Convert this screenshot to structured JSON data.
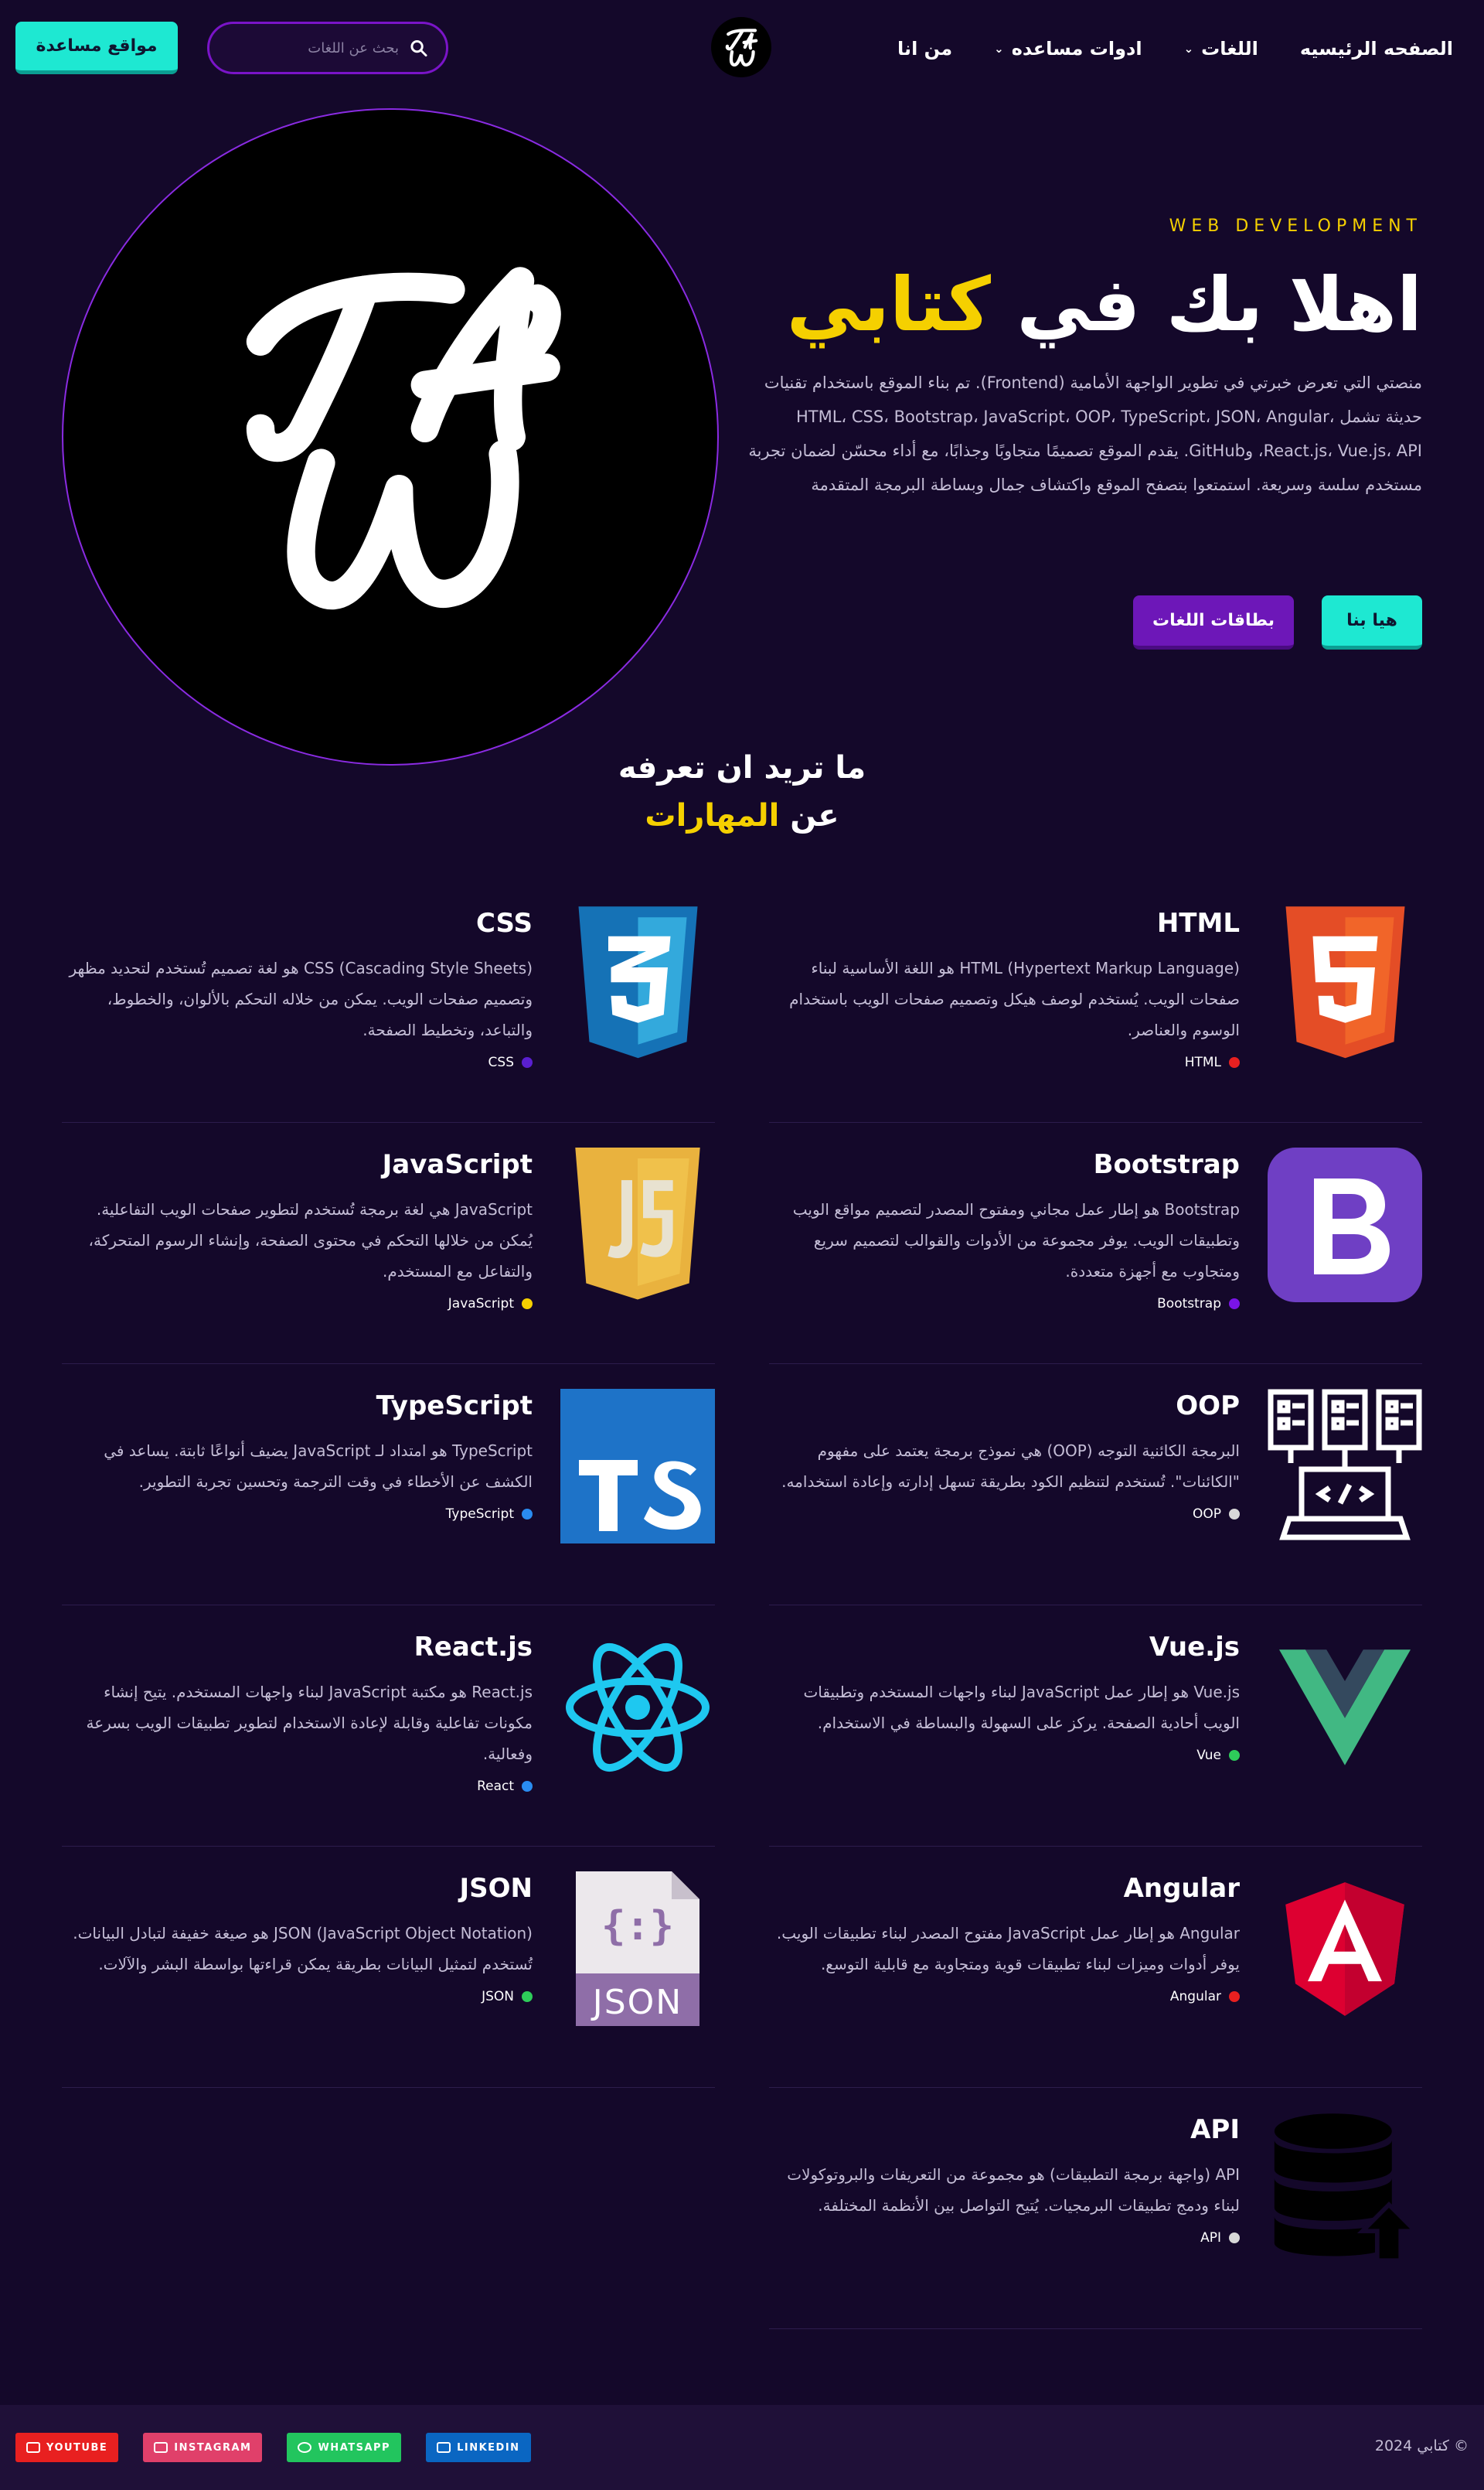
{
  "nav": {
    "items": [
      {
        "label": "الصفحه الرئيسيه",
        "dropdown": false
      },
      {
        "label": "اللغات",
        "dropdown": true
      },
      {
        "label": "ادوات مساعده",
        "dropdown": true
      },
      {
        "label": "من انا",
        "dropdown": false
      }
    ],
    "logo_text": "TAW",
    "search_placeholder": "بحث عن اللغات",
    "help_button": "مواقع مساعدة"
  },
  "hero": {
    "eyebrow": "WEB DEVELOPMENT",
    "title_main": "اهلا بك في",
    "title_accent": "كتابي",
    "description": "منصتي التي تعرض خبرتي في تطوير الواجهة الأمامية (Frontend). تم بناء الموقع باستخدام تقنيات حديثة تشمل HTML، CSS، Bootstrap، JavaScript، OOP، TypeScript، JSON، Angular، React.js، Vue.js، API، وGitHub. يقدم الموقع تصميمًا متجاوبًا وجذابًا، مع أداء محسّن لضمان تجربة مستخدم سلسة وسريعة. استمتعوا بتصفح الموقع واكتشاف جمال وبساطة البرمجة المتقدمة",
    "primary_button": "هيا بنا",
    "secondary_button": "بطاقات اللغات",
    "logo_text": "TAW"
  },
  "skills_heading": {
    "line1": "ما تريد ان تعرفه",
    "line2_prefix": "عن",
    "line2_accent": "المهارات"
  },
  "skills": [
    {
      "title": "HTML",
      "desc": "HTML (Hypertext Markup Language) هو اللغة الأساسية لبناء صفحات الويب. يُستخدم لوصف هيكل وتصميم صفحات الويب باستخدام الوسوم والعناصر.",
      "tag": "HTML",
      "dot_color": "#e82020",
      "icon": "html5-icon"
    },
    {
      "title": "CSS",
      "desc": "CSS (Cascading Style Sheets) هو لغة تصميم تُستخدم لتحديد مظهر وتصميم صفحات الويب. يمكن من خلاله التحكم بالألوان، والخطوط، والتباعد، وتخطيط الصفحة.",
      "tag": "CSS",
      "dot_color": "#5a1fd0",
      "icon": "css3-icon"
    },
    {
      "title": "Bootstrap",
      "desc": "Bootstrap هو إطار عمل مجاني ومفتوح المصدر لتصميم مواقع الويب وتطبيقات الويب. يوفر مجموعة من الأدوات والقوالب لتصميم سريع ومتجاوب مع أجهزة متعددة.",
      "tag": "Bootstrap",
      "dot_color": "#7a14e8",
      "icon": "bootstrap-icon"
    },
    {
      "title": "JavaScript",
      "desc": "JavaScript هي لغة برمجة تُستخدم لتطوير صفحات الويب التفاعلية. يُمكن من خلالها التحكم في محتوى الصفحة، وإنشاء الرسوم المتحركة، والتفاعل مع المستخدم.",
      "tag": "JavaScript",
      "dot_color": "#f5d000",
      "icon": "javascript-icon"
    },
    {
      "title": "OOP",
      "desc": "البرمجة الكائنية التوجه (OOP) هي نموذج برمجة يعتمد على مفهوم \"الكائنات\". تُستخدم لتنظيم الكود بطريقة تسهل إدارته وإعادة استخدامه.",
      "tag": "OOP",
      "dot_color": "#d8d8d8",
      "icon": "oop-servers-icon"
    },
    {
      "title": "TypeScript",
      "desc": "TypeScript هو امتداد لـ JavaScript يضيف أنواعًا ثابتة. يساعد في الكشف عن الأخطاء في وقت الترجمة وتحسين تجربة التطوير.",
      "tag": "TypeScript",
      "dot_color": "#2a8cf0",
      "icon": "typescript-icon"
    },
    {
      "title": "Vue.js",
      "desc": "Vue.js هو إطار عمل JavaScript لبناء واجهات المستخدم وتطبيقات الويب أحادية الصفحة. يركز على السهولة والبساطة في الاستخدام.",
      "tag": "Vue",
      "dot_color": "#2ecc5a",
      "icon": "vue-icon"
    },
    {
      "title": "React.js",
      "desc": "React.js هو مكتبة JavaScript لبناء واجهات المستخدم. يتيح إنشاء مكونات تفاعلية وقابلة لإعادة الاستخدام لتطوير تطبيقات الويب بسرعة وفعالية.",
      "tag": "React",
      "dot_color": "#2a8cf0",
      "icon": "react-icon"
    },
    {
      "title": "Angular",
      "desc": "Angular هو إطار عمل JavaScript مفتوح المصدر لبناء تطبيقات الويب. يوفر أدوات وميزات لبناء تطبيقات قوية ومتجاوبة مع قابلية التوسع.",
      "tag": "Angular",
      "dot_color": "#e82020",
      "icon": "angular-icon"
    },
    {
      "title": "JSON",
      "desc": "JSON (JavaScript Object Notation) هو صيغة خفيفة لتبادل البيانات. تُستخدم لتمثيل البيانات بطريقة يمكن قراءتها بواسطة البشر والآلات.",
      "tag": "JSON",
      "dot_color": "#2ecc5a",
      "icon": "json-file-icon"
    },
    {
      "title": "API",
      "desc": "API (واجهة برمجة التطبيقات) هو مجموعة من التعريفات والبروتوكولات لبناء ودمج تطبيقات البرمجيات. يُتيح التواصل بين الأنظمة المختلفة.",
      "tag": "API",
      "dot_color": "#d8d8d8",
      "icon": "database-upload-icon"
    }
  ],
  "footer": {
    "copyright": "© كتابي 2024",
    "socials": [
      {
        "label": "YOUTUBE",
        "color": "#e82020",
        "icon": "youtube-icon"
      },
      {
        "label": "INSTAGRAM",
        "color": "#e0406a",
        "icon": "instagram-icon"
      },
      {
        "label": "WHATSAPP",
        "color": "#22c55e",
        "icon": "whatsapp-icon"
      },
      {
        "label": "LINKEDIN",
        "color": "#0a66c2",
        "icon": "linkedin-icon"
      }
    ]
  },
  "colors": {
    "background": "#14082a",
    "accent_yellow": "#f5d000",
    "accent_teal": "#1ee8d2",
    "accent_purple": "#6d17b8"
  }
}
